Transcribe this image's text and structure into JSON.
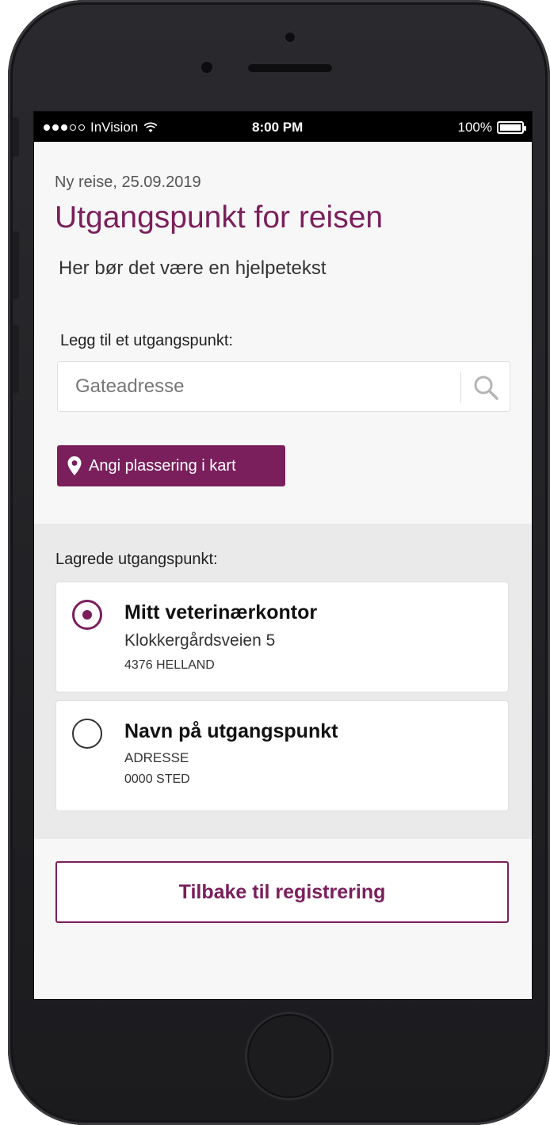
{
  "status_bar": {
    "carrier": "InVision",
    "time": "8:00 PM",
    "battery": "100%"
  },
  "page": {
    "subtitle": "Ny reise, 25.09.2019",
    "title": "Utgangspunkt for reisen",
    "help_text": "Her bør det være en hjelpetekst"
  },
  "search": {
    "label": "Legg til et utgangspunkt:",
    "placeholder": "Gateadresse",
    "value": ""
  },
  "map_button": {
    "label": "Angi plassering i kart"
  },
  "saved": {
    "label": "Lagrede utgangspunkt:",
    "items": [
      {
        "name": "Mitt veterinærkontor",
        "line1": "Klokkergårdsveien 5",
        "line2": "4376 HELLAND",
        "selected": true
      },
      {
        "name": "Navn på utgangspunkt",
        "line1": "ADRESSE",
        "line2": "0000 STED",
        "selected": false
      }
    ]
  },
  "back_button": {
    "label": "Tilbake til registrering"
  },
  "icons": {
    "search": "search-icon",
    "location": "map-pin-icon",
    "wifi": "wifi-icon",
    "battery": "battery-icon"
  },
  "colors": {
    "accent": "#7a1f5c",
    "section_bg": "#eaeaea",
    "screen_bg": "#f7f7f7"
  }
}
